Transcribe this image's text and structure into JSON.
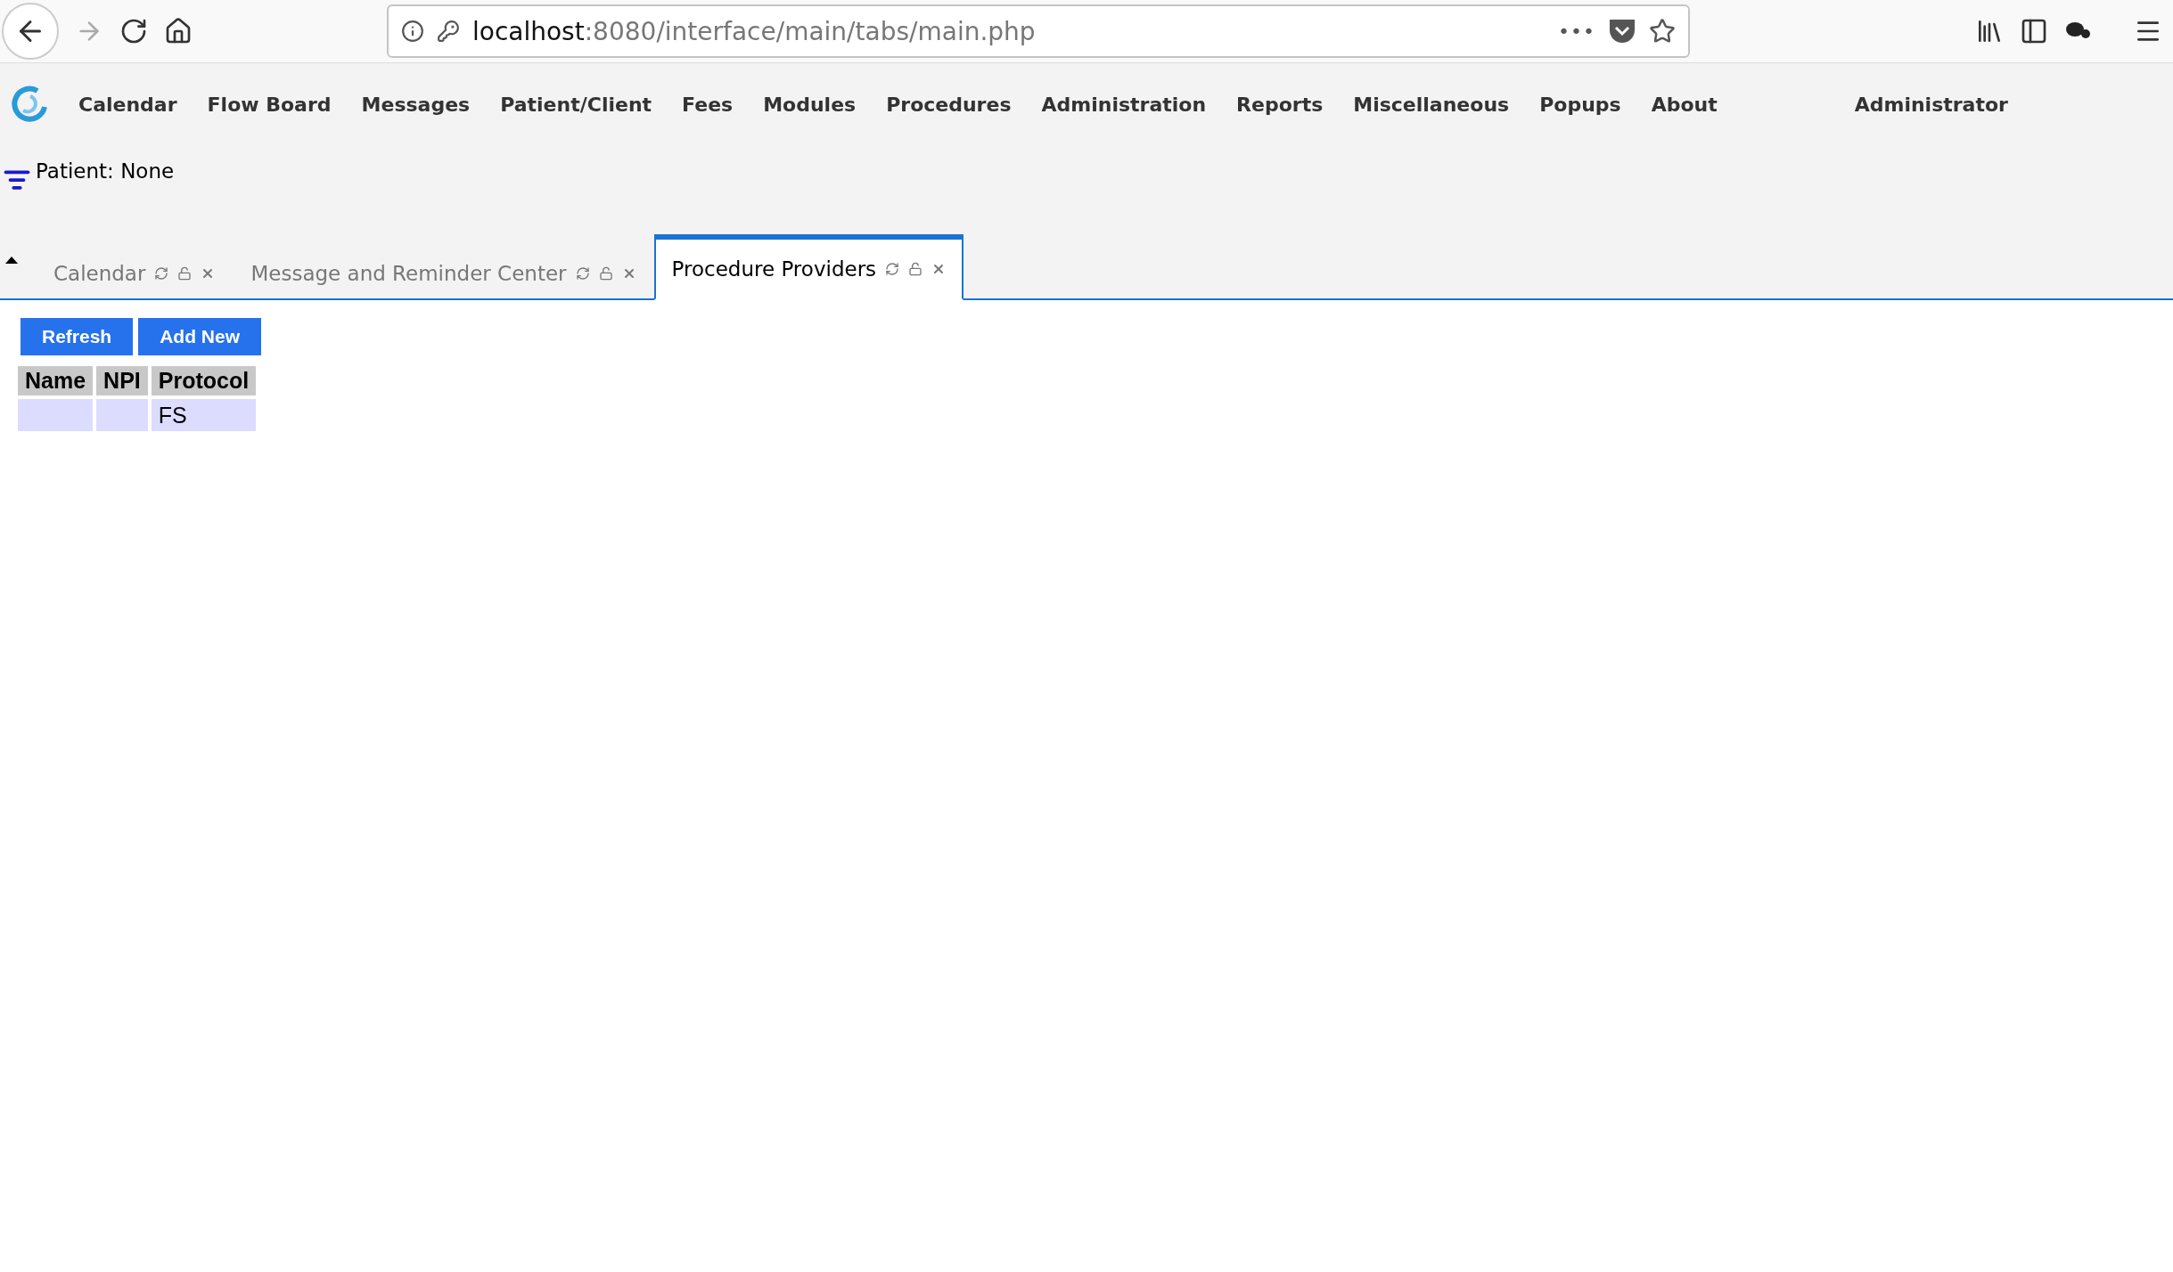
{
  "browser": {
    "url_host": "localhost",
    "url_path": ":8080/interface/main/tabs/main.php",
    "more": "•••"
  },
  "menu": {
    "items": [
      "Calendar",
      "Flow Board",
      "Messages",
      "Patient/Client",
      "Fees",
      "Modules",
      "Procedures",
      "Administration",
      "Reports",
      "Miscellaneous",
      "Popups",
      "About"
    ],
    "user": "Administrator"
  },
  "patient": "Patient: None",
  "tabs": [
    {
      "label": "Calendar",
      "selected": false
    },
    {
      "label": "Message and Reminder Center",
      "selected": false
    },
    {
      "label": "Procedure Providers",
      "selected": true
    }
  ],
  "buttons": [
    "Refresh",
    "Add New"
  ],
  "table": {
    "columns": [
      "Name",
      "NPI",
      "Protocol"
    ],
    "rows": [
      [
        "",
        "",
        "FS"
      ]
    ]
  }
}
